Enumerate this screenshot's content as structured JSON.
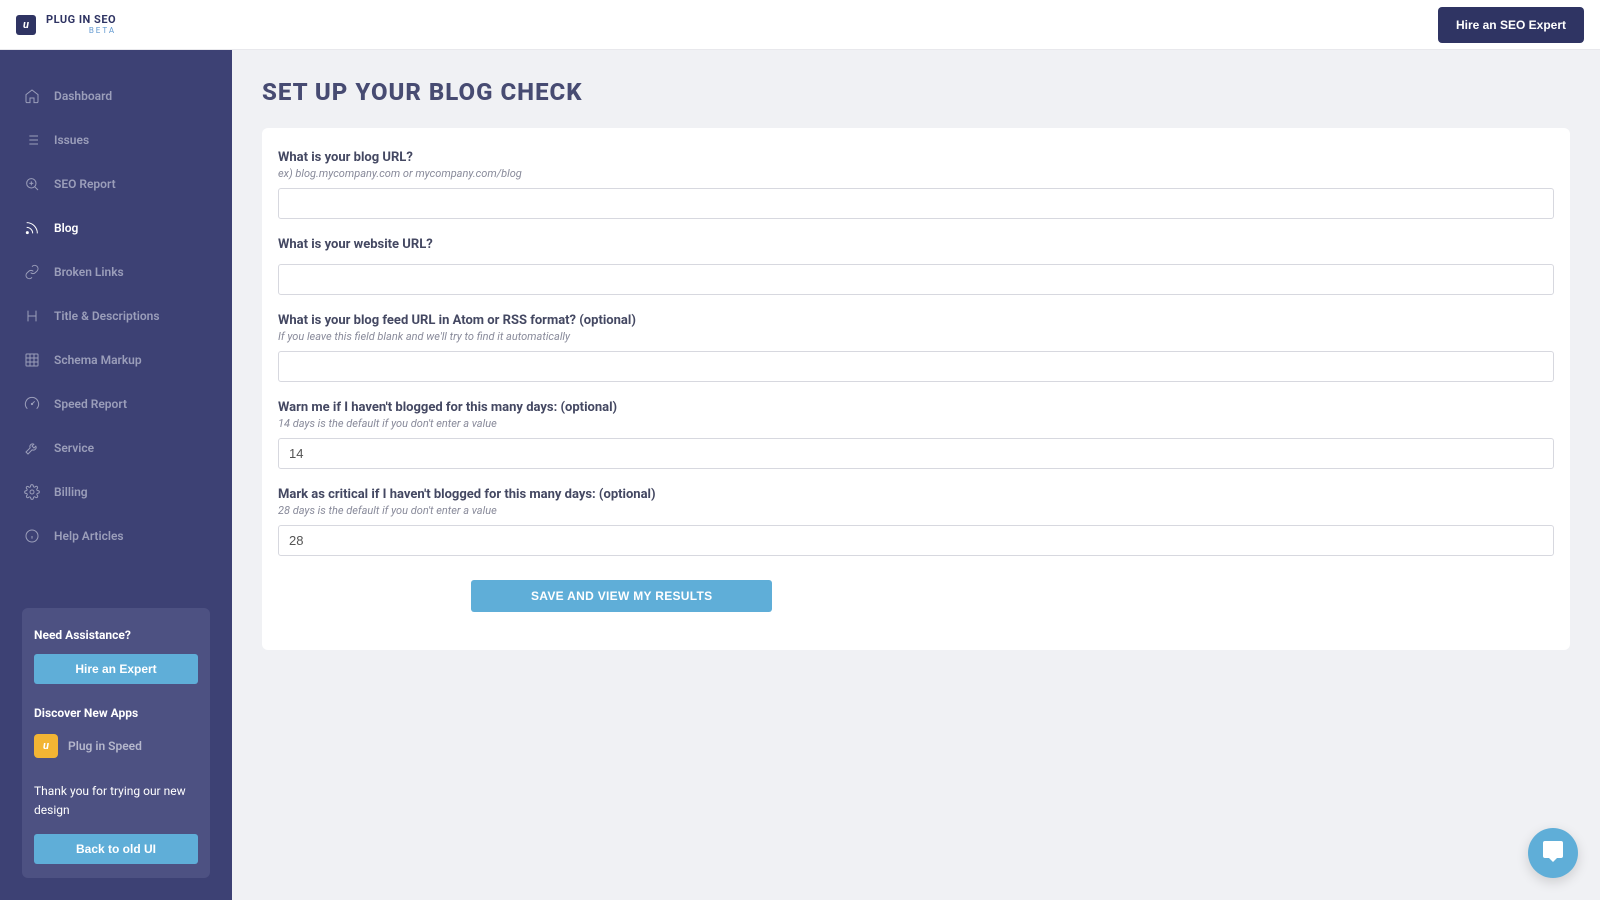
{
  "header": {
    "logo_text": "PLUG IN SEO",
    "logo_beta": "BETA",
    "hire_button": "Hire an SEO Expert"
  },
  "sidebar": {
    "items": [
      {
        "label": "Dashboard",
        "icon": "home"
      },
      {
        "label": "Issues",
        "icon": "list"
      },
      {
        "label": "SEO Report",
        "icon": "zoom"
      },
      {
        "label": "Blog",
        "icon": "rss",
        "active": true
      },
      {
        "label": "Broken Links",
        "icon": "link"
      },
      {
        "label": "Title & Descriptions",
        "icon": "heading"
      },
      {
        "label": "Schema Markup",
        "icon": "grid"
      },
      {
        "label": "Speed Report",
        "icon": "speed"
      },
      {
        "label": "Service",
        "icon": "wrench"
      },
      {
        "label": "Billing",
        "icon": "gear"
      },
      {
        "label": "Help Articles",
        "icon": "info"
      }
    ],
    "assist_title": "Need Assistance?",
    "assist_button": "Hire an Expert",
    "discover_title": "Discover New Apps",
    "app_label": "Plug in Speed",
    "thanks_text": "Thank you for trying our new design",
    "back_button": "Back to old UI"
  },
  "page": {
    "title": "SET UP YOUR BLOG CHECK"
  },
  "form": {
    "blog_url_label": "What is your blog URL?",
    "blog_url_hint": "ex) blog.mycompany.com or mycompany.com/blog",
    "blog_url_value": "",
    "website_url_label": "What is your website URL?",
    "website_url_value": "",
    "feed_url_label": "What is your blog feed URL in Atom or RSS format? (optional)",
    "feed_url_hint": "If you leave this field blank and we'll try to find it automatically",
    "feed_url_value": "",
    "warn_label": "Warn me if I haven't blogged for this many days: (optional)",
    "warn_hint": "14 days is the default if you don't enter a value",
    "warn_value": "14",
    "critical_label": "Mark as critical if I haven't blogged for this many days: (optional)",
    "critical_hint": "28 days is the default if you don't enter a value",
    "critical_value": "28",
    "save_button": "SAVE AND VIEW MY RESULTS"
  }
}
